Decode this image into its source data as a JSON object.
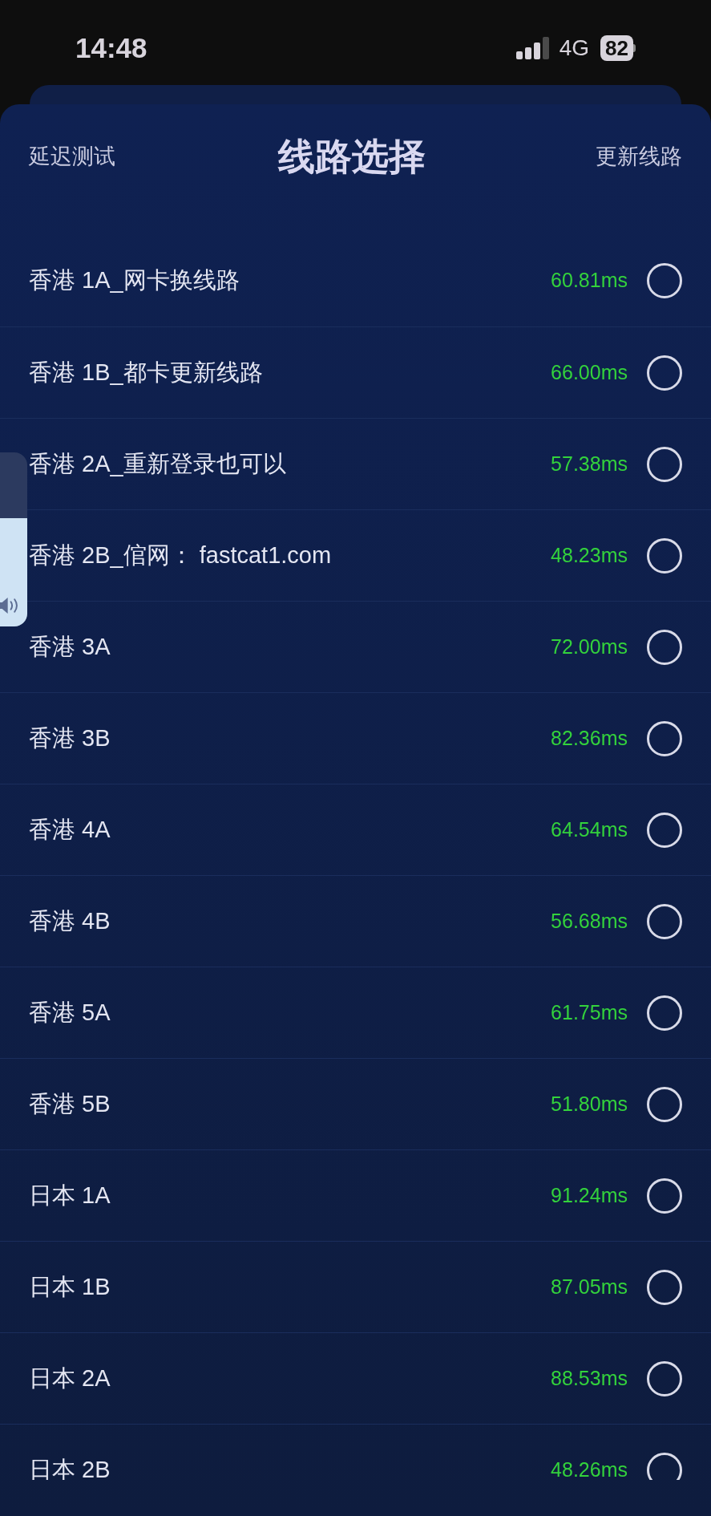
{
  "status_bar": {
    "time": "14:48",
    "network": "4G",
    "battery": "82"
  },
  "header": {
    "left_action": "延迟测试",
    "title": "线路选择",
    "right_action": "更新线路"
  },
  "routes": [
    {
      "name": "香港 1A_网卡换线路",
      "latency": "60.81ms",
      "selected": false
    },
    {
      "name": "香港 1B_都卡更新线路",
      "latency": "66.00ms",
      "selected": false
    },
    {
      "name": "香港 2A_重新登录也可以",
      "latency": "57.38ms",
      "selected": false
    },
    {
      "name": "香港 2B_倌网： fastcat1.com",
      "latency": "48.23ms",
      "selected": false
    },
    {
      "name": "香港 3A",
      "latency": "72.00ms",
      "selected": false
    },
    {
      "name": "香港 3B",
      "latency": "82.36ms",
      "selected": false
    },
    {
      "name": "香港 4A",
      "latency": "64.54ms",
      "selected": false
    },
    {
      "name": "香港 4B",
      "latency": "56.68ms",
      "selected": false
    },
    {
      "name": "香港 5A",
      "latency": "61.75ms",
      "selected": false
    },
    {
      "name": "香港 5B",
      "latency": "51.80ms",
      "selected": false
    },
    {
      "name": "日本 1A",
      "latency": "91.24ms",
      "selected": false
    },
    {
      "name": "日本 1B",
      "latency": "87.05ms",
      "selected": false
    },
    {
      "name": "日本 2A",
      "latency": "88.53ms",
      "selected": false
    },
    {
      "name": "日本 2B",
      "latency": "48.26ms",
      "selected": false
    }
  ],
  "volume_hud": {
    "level": 0.62
  }
}
